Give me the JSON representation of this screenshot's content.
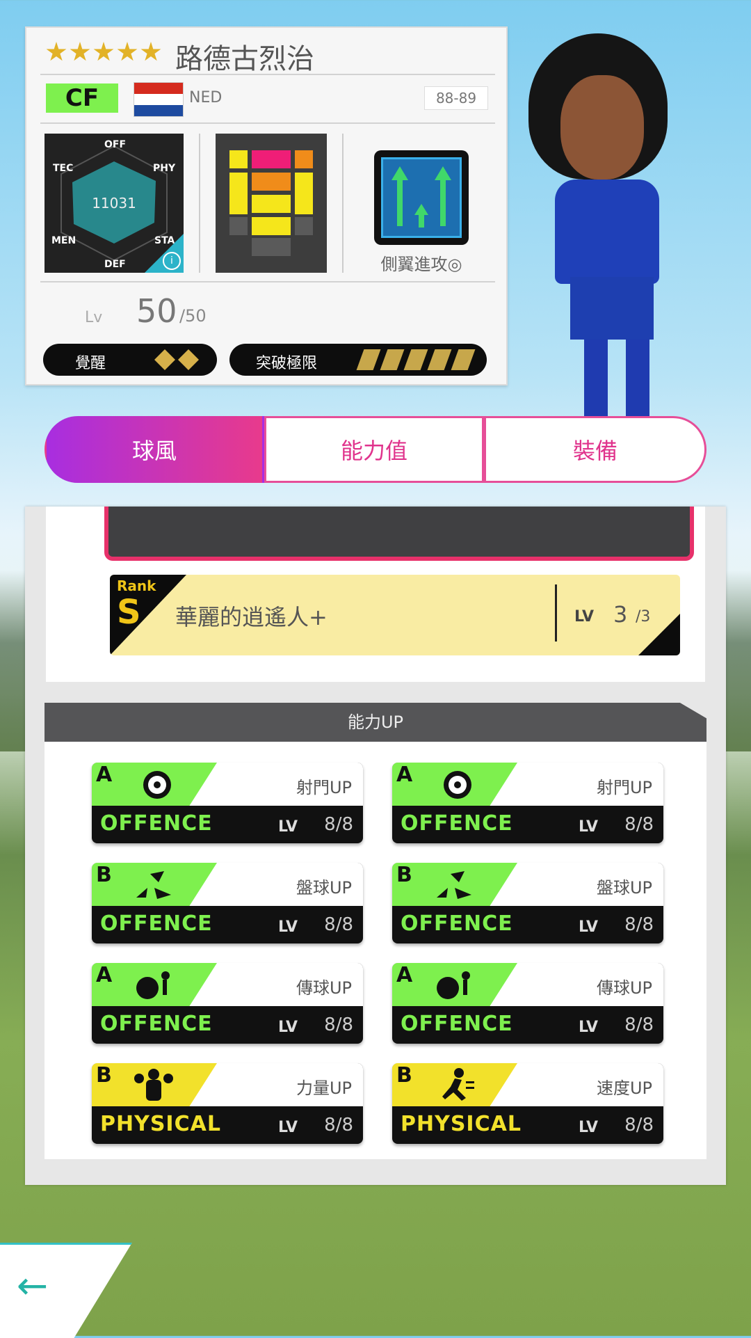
{
  "player": {
    "rarity_stars": 5,
    "name": "路德古烈治",
    "position": "CF",
    "country": "NED",
    "season": "88-89",
    "radar": {
      "value": "11031",
      "labels": [
        "OFF",
        "PHY",
        "STA",
        "DEF",
        "MEN",
        "TEC"
      ]
    },
    "tactic_label": "側翼進攻◎",
    "level": {
      "label": "Lv",
      "value": "50",
      "max": "/50"
    },
    "awaken": {
      "label": "覺醒",
      "count": 2
    },
    "limit_break": {
      "label": "突破極限",
      "count": 5
    }
  },
  "tabs": [
    {
      "label": "球風",
      "active": true
    },
    {
      "label": "能力值",
      "active": false
    },
    {
      "label": "裝備",
      "active": false
    }
  ],
  "skill": {
    "rank_label": "Rank",
    "rank": "S",
    "name": "華麗的逍遙人+",
    "lv_label": "LV",
    "lv": "3",
    "lv_max": "/3"
  },
  "abilities_header": "能力UP",
  "abilities": [
    {
      "grade": "A",
      "icon": "soccer-ball-shot-icon",
      "name": "射門UP",
      "category": "OFFENCE",
      "lv_label": "LV",
      "lv": "8/8",
      "color": "#7ef04e"
    },
    {
      "grade": "A",
      "icon": "soccer-ball-shot-icon",
      "name": "射門UP",
      "category": "OFFENCE",
      "lv_label": "LV",
      "lv": "8/8",
      "color": "#7ef04e"
    },
    {
      "grade": "B",
      "icon": "dribble-arrows-icon",
      "name": "盤球UP",
      "category": "OFFENCE",
      "lv_label": "LV",
      "lv": "8/8",
      "color": "#7ef04e"
    },
    {
      "grade": "B",
      "icon": "dribble-arrows-icon",
      "name": "盤球UP",
      "category": "OFFENCE",
      "lv_label": "LV",
      "lv": "8/8",
      "color": "#7ef04e"
    },
    {
      "grade": "A",
      "icon": "pass-kick-icon",
      "name": "傳球UP",
      "category": "OFFENCE",
      "lv_label": "LV",
      "lv": "8/8",
      "color": "#7ef04e"
    },
    {
      "grade": "A",
      "icon": "pass-kick-icon",
      "name": "傳球UP",
      "category": "OFFENCE",
      "lv_label": "LV",
      "lv": "8/8",
      "color": "#7ef04e"
    },
    {
      "grade": "B",
      "icon": "muscle-icon",
      "name": "力量UP",
      "category": "PHYSICAL",
      "lv_label": "LV",
      "lv": "8/8",
      "color": "#f2e12b"
    },
    {
      "grade": "B",
      "icon": "running-icon",
      "name": "速度UP",
      "category": "PHYSICAL",
      "lv_label": "LV",
      "lv": "8/8",
      "color": "#f2e12b"
    }
  ],
  "colors": {
    "accent": "#e7316a",
    "offence": "#7ef04e",
    "physical": "#f2e12b",
    "back": "#24b3a6"
  }
}
